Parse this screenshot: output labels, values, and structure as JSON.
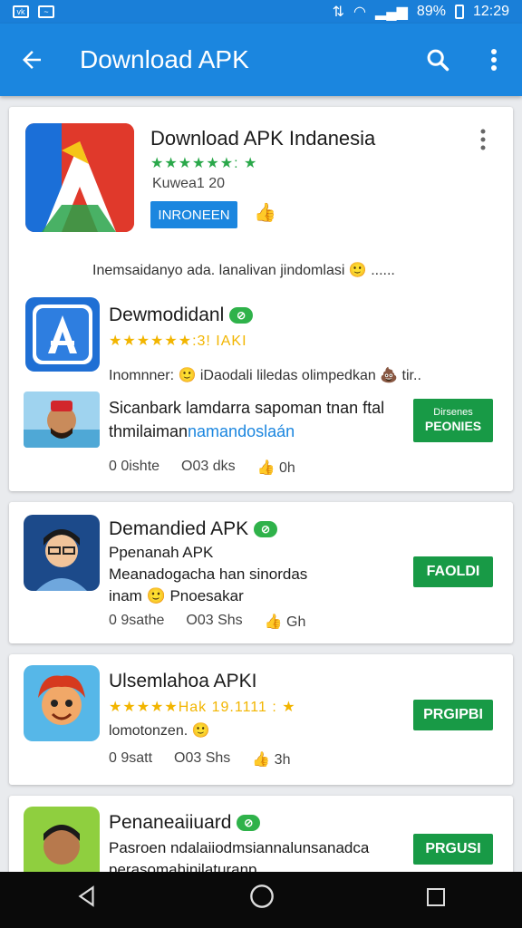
{
  "status_bar": {
    "left_icons": [
      "vk-icon",
      "activity-icon"
    ],
    "battery": "89%",
    "time": "12:29"
  },
  "app_bar": {
    "title": "Download APK"
  },
  "featured": {
    "title": "Download APK Indanesia",
    "stars": "★★★★★★: ★",
    "badge": "Ⓖ",
    "version": "Kuwea1 20",
    "install_label": "INRONEEN",
    "promo_text": "Inemsaidanyo ada. lanalivan jindomlasi 🙂  ......"
  },
  "subapp": {
    "title": "Dewmodidanl",
    "badge": "⊘",
    "stars": "★★★★★★:3! IAKI",
    "subtitle": "Inomnner: 🙂 iDaodali liledas olimpedkan 💩 tir..",
    "desc_line1": "Sicanbark lamdarra sapoman tnan ftal",
    "desc_line2_pre": "thmilaiman",
    "desc_line2_link": "namandoslaán",
    "button_top": "Dirsenes",
    "button_label": "PEONIES",
    "meta": [
      "0 0ishte",
      "O03 dks",
      "0h"
    ]
  },
  "app2": {
    "title": "Demandied APK",
    "badge": "⊘",
    "line1": "Ppenanah APK",
    "line2": "Meanadogacha han sinordas",
    "line3": "inam 🙂 Pnoesakar",
    "button_label": "FAOLDI",
    "meta": [
      "0 9sathe",
      "O03 Shs",
      "Gh"
    ]
  },
  "app3": {
    "title": "Ulsemlahoa APKI",
    "stars": "★★★★★Hak 19.1111 : ★",
    "line1": "lomotonzen. 🙂",
    "button_label": "PRGIPBI",
    "meta": [
      "0 9satt",
      "O03 Shs",
      "3h"
    ]
  },
  "app4": {
    "title": "Penaneaiiuard",
    "line1": "Pasroen ndalaiiodmsiannalunsanadca",
    "line2": "perasomahinilaturanp",
    "button_label": "PRGUSI"
  },
  "colors": {
    "primary": "#1b86df",
    "green_button": "#189a46",
    "star_green": "#2aa84a",
    "star_yellow": "#f2b500"
  }
}
